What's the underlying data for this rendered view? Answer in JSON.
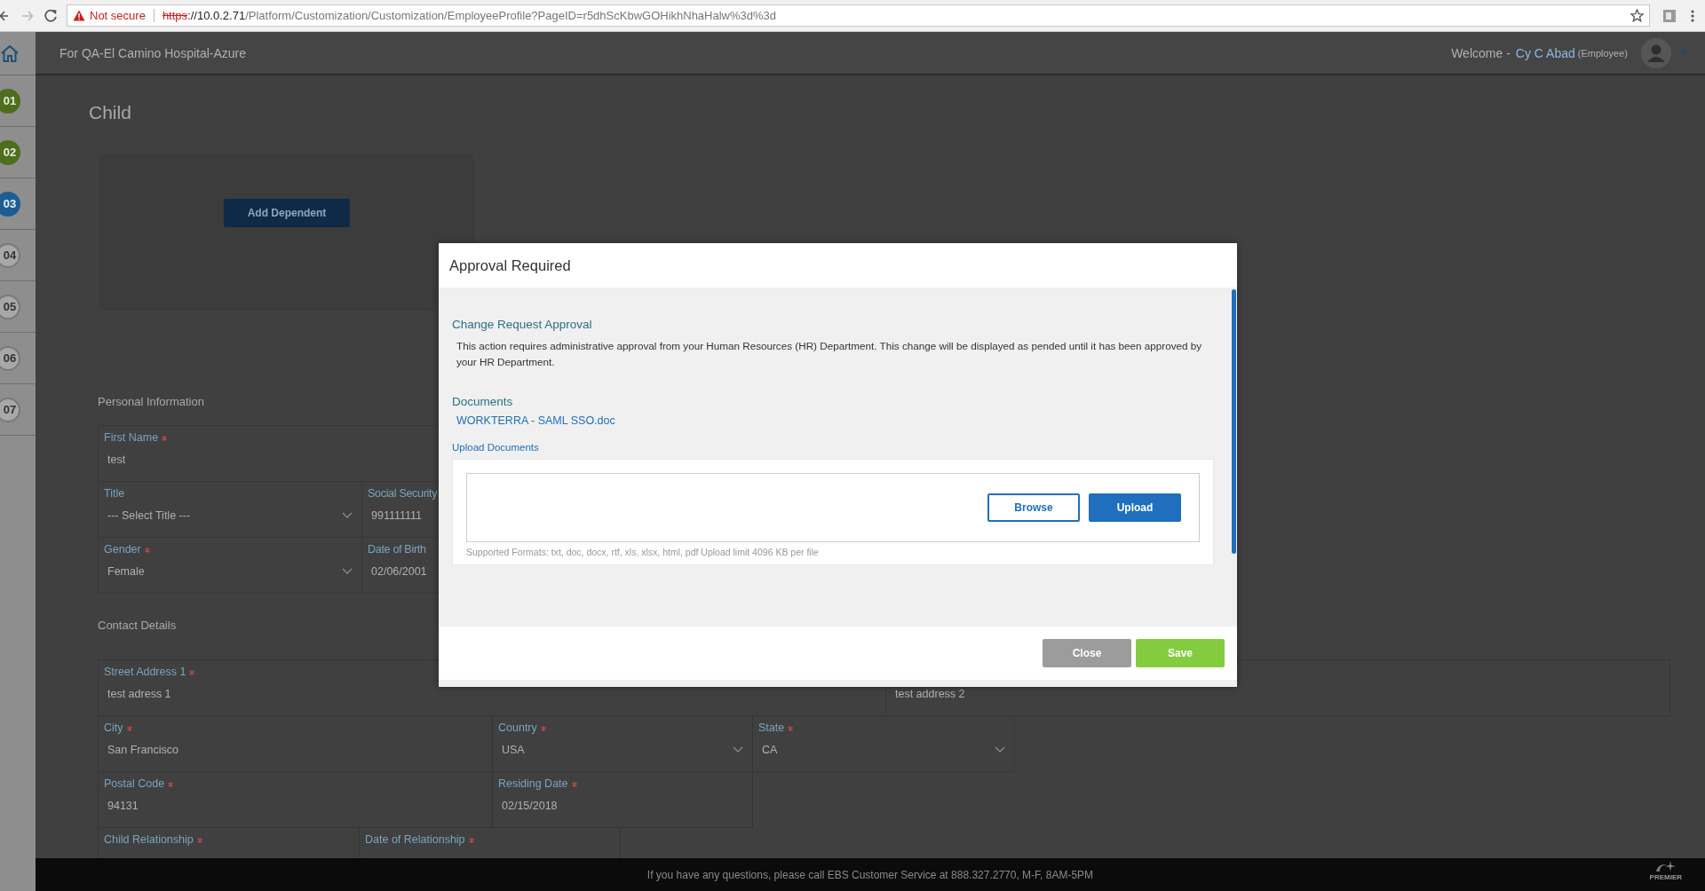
{
  "browser": {
    "security": "Not secure",
    "url": {
      "scheme": "https",
      "host": "://10.0.2.71",
      "path": "/Platform/Customization/Customization/EmployeeProfile?PageID=r5dhScKbwGOHikhNhaHalw%3d%3d"
    }
  },
  "header": {
    "title": "For QA-El Camino Hospital-Azure",
    "welcome": "Welcome -",
    "user": "Cy C Abad",
    "role": "(Employee)"
  },
  "steps": [
    {
      "label": "01",
      "completed": true,
      "selected": false
    },
    {
      "label": "02",
      "completed": true,
      "selected": false
    },
    {
      "label": "03",
      "completed": false,
      "selected": true
    },
    {
      "label": "04",
      "completed": false,
      "selected": false
    },
    {
      "label": "05",
      "completed": false,
      "selected": false
    },
    {
      "label": "06",
      "completed": false,
      "selected": false
    },
    {
      "label": "07",
      "completed": false,
      "selected": false
    }
  ],
  "page": {
    "title": "Child",
    "add_button": "Add Dependent"
  },
  "sections": [
    {
      "title": "Personal Information",
      "rows": [
        [
          {
            "label": "First Name",
            "required": true,
            "value": "test",
            "kind": "text"
          }
        ],
        [
          {
            "label": "Title",
            "required": false,
            "value": "--- Select Title ---",
            "kind": "select"
          },
          {
            "label": "Social Security",
            "required": false,
            "value": "991111111",
            "kind": "text"
          }
        ],
        [
          {
            "label": "Gender",
            "required": true,
            "value": "Female",
            "kind": "select"
          },
          {
            "label": "Date of Birth",
            "required": false,
            "value": "02/06/2001",
            "kind": "text"
          }
        ]
      ]
    },
    {
      "title": "Contact Details",
      "rows": [
        [
          {
            "label": "Street Address 1",
            "required": true,
            "value": "test adress 1",
            "kind": "text"
          },
          {
            "value": "test address 2",
            "kind": "text"
          }
        ],
        [
          {
            "label": "City",
            "required": true,
            "value": "San Francisco",
            "kind": "text"
          },
          {
            "label": "Country",
            "required": true,
            "value": "USA",
            "kind": "select"
          },
          {
            "label": "State",
            "required": true,
            "value": "CA",
            "kind": "select"
          }
        ],
        [
          {
            "label": "Postal Code",
            "required": true,
            "value": "94131",
            "kind": "text"
          },
          {
            "label": "Residing Date",
            "required": true,
            "value": "02/15/2018",
            "kind": "text"
          }
        ],
        [
          {
            "label": "Child Relationship",
            "required": true,
            "kind": "text"
          },
          {
            "label": "Date of Relationship",
            "required": true,
            "kind": "text"
          }
        ]
      ]
    }
  ],
  "modal": {
    "title": "Approval Required",
    "heading": "Change Request Approval",
    "message": "This action requires administrative approval from your Human Resources (HR) Department. This change will be displayed as pended until it has been approved by your HR Department.",
    "documents_title": "Documents",
    "documents": [
      "WORKTERRA - SAML SSO.doc"
    ],
    "upload_title": "Upload Documents",
    "browse": "Browse",
    "upload": "Upload",
    "formats": "Supported Formats: txt, doc, docx, rtf, xls, xlsx, html, pdf Upload limit 4096 KB per file",
    "buttons": [
      {
        "label": "Close",
        "kind": "secondary"
      },
      {
        "label": "Save",
        "kind": "primary"
      }
    ]
  },
  "footer": {
    "text": "If you have any questions, please call EBS Customer Service at 888.327.2770, M-F, 8AM-5PM",
    "logo": "PREMIER"
  }
}
